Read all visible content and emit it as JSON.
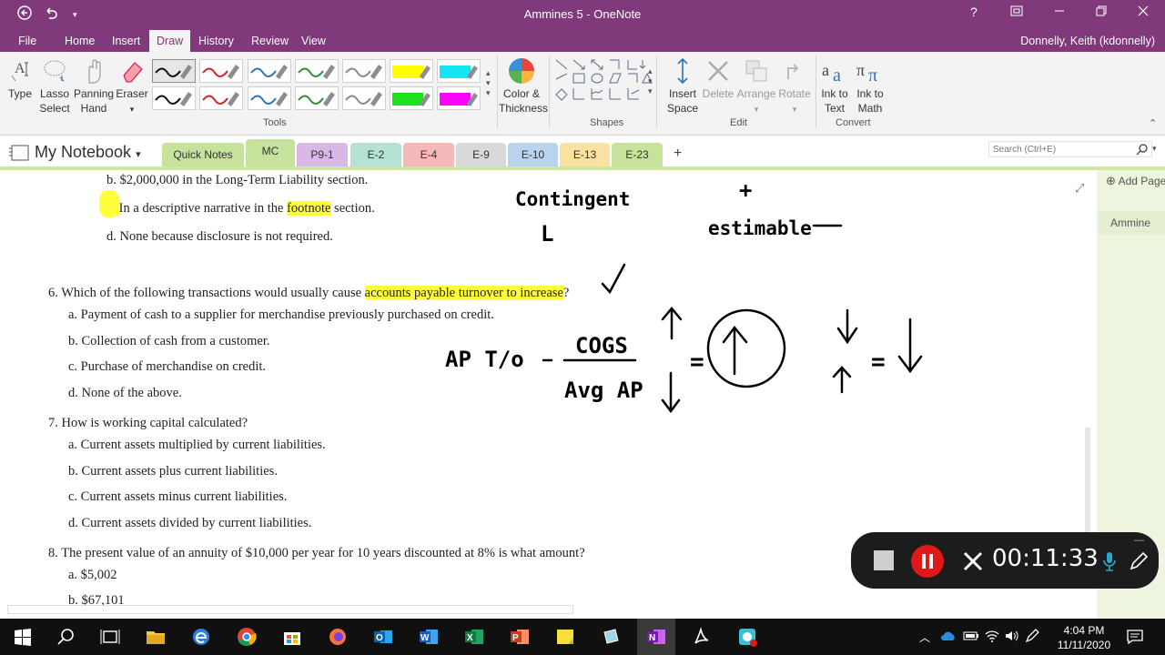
{
  "window": {
    "title": "Ammines 5 - OneNote"
  },
  "menu": {
    "items": [
      "File",
      "Home",
      "Insert",
      "Draw",
      "History",
      "Review",
      "View"
    ],
    "active": "Draw",
    "user": "Donnelly, Keith (kdonnelly)"
  },
  "ribbon": {
    "tools": {
      "type": "Type",
      "lasso_1": "Lasso",
      "lasso_2": "Select",
      "panning_1": "Panning",
      "panning_2": "Hand",
      "eraser": "Eraser",
      "label": "Tools"
    },
    "color_thickness_1": "Color &",
    "color_thickness_2": "Thickness",
    "shapes_label": "Shapes",
    "edit": {
      "insert_space_1": "Insert",
      "insert_space_2": "Space",
      "delete": "Delete",
      "arrange": "Arrange",
      "rotate": "Rotate",
      "label": "Edit"
    },
    "convert": {
      "ink_text_1": "Ink to",
      "ink_text_2": "Text",
      "ink_math_1": "Ink to",
      "ink_math_2": "Math",
      "label": "Convert"
    },
    "pen_colors": [
      "#111111",
      "#d81f26",
      "#2e75b6",
      "#2f8f3a",
      "#8a8a8a",
      "#ffff00",
      "#17e6f0",
      "#111111",
      "#d81f26",
      "#2e75b6",
      "#2f8f3a",
      "#8a8a8a",
      "#1fe01f",
      "#ff00ff"
    ]
  },
  "notebook": {
    "name": "My Notebook",
    "tabs": [
      {
        "label": "Quick Notes",
        "color": "#c6e29b"
      },
      {
        "label": "MC",
        "color": "#c6e29b"
      },
      {
        "label": "P9-1",
        "color": "#d9b8e8"
      },
      {
        "label": "E-2",
        "color": "#b4e3d6"
      },
      {
        "label": "E-4",
        "color": "#f6b9b9"
      },
      {
        "label": "E-9",
        "color": "#d9d9d9"
      },
      {
        "label": "E-10",
        "color": "#b9d3ef"
      },
      {
        "label": "E-13",
        "color": "#fbe2a0"
      },
      {
        "label": "E-23",
        "color": "#c6e29b"
      }
    ],
    "add_tab": "+",
    "search_placeholder": "Search (Ctrl+E)"
  },
  "content": {
    "prev_b": "b. $2,000,000 in the Long-Term Liability section.",
    "prev_c_pre": "c. In a descriptive narrative in the ",
    "prev_c_hl": "footnote",
    "prev_c_post": " section.",
    "prev_d": "d. None because disclosure is not required.",
    "q6_pre": "6. Which of the following transactions would usually cause ",
    "q6_hl": "accounts payable turnover to increase",
    "q6_post": "?",
    "q6_a": "a. Payment of cash to a supplier for merchandise previously purchased on credit.",
    "q6_b": "b. Collection of cash from a customer.",
    "q6_c": "c. Purchase of merchandise on credit.",
    "q6_d": "d. None of the above.",
    "q7": "7. How is working capital calculated?",
    "q7_a": "a. Current assets multiplied by current liabilities.",
    "q7_b": "b. Current assets plus current liabilities.",
    "q7_c": "c. Current assets minus current liabilities.",
    "q7_d": "d. Current assets divided by current liabilities.",
    "q8": "8. The present value of an annuity of $10,000 per year for 10 years discounted at 8% is what amount?",
    "q8_a": "a. $5,002",
    "q8_b": "b. $67,101"
  },
  "ink": {
    "contingent": "Contingent",
    "L": "L",
    "plus": "+",
    "estimable": "estimable",
    "ap_to": "AP T/o",
    "equals1": "=",
    "cogs": "COGS",
    "avg_ap": "Avg AP",
    "equals2": "="
  },
  "right_pane": {
    "add_page": "Add Page",
    "page_name": "Ammine"
  },
  "recorder": {
    "time": "00:11:33"
  },
  "taskbar": {
    "time": "4:04 PM",
    "date": "11/11/2020"
  }
}
